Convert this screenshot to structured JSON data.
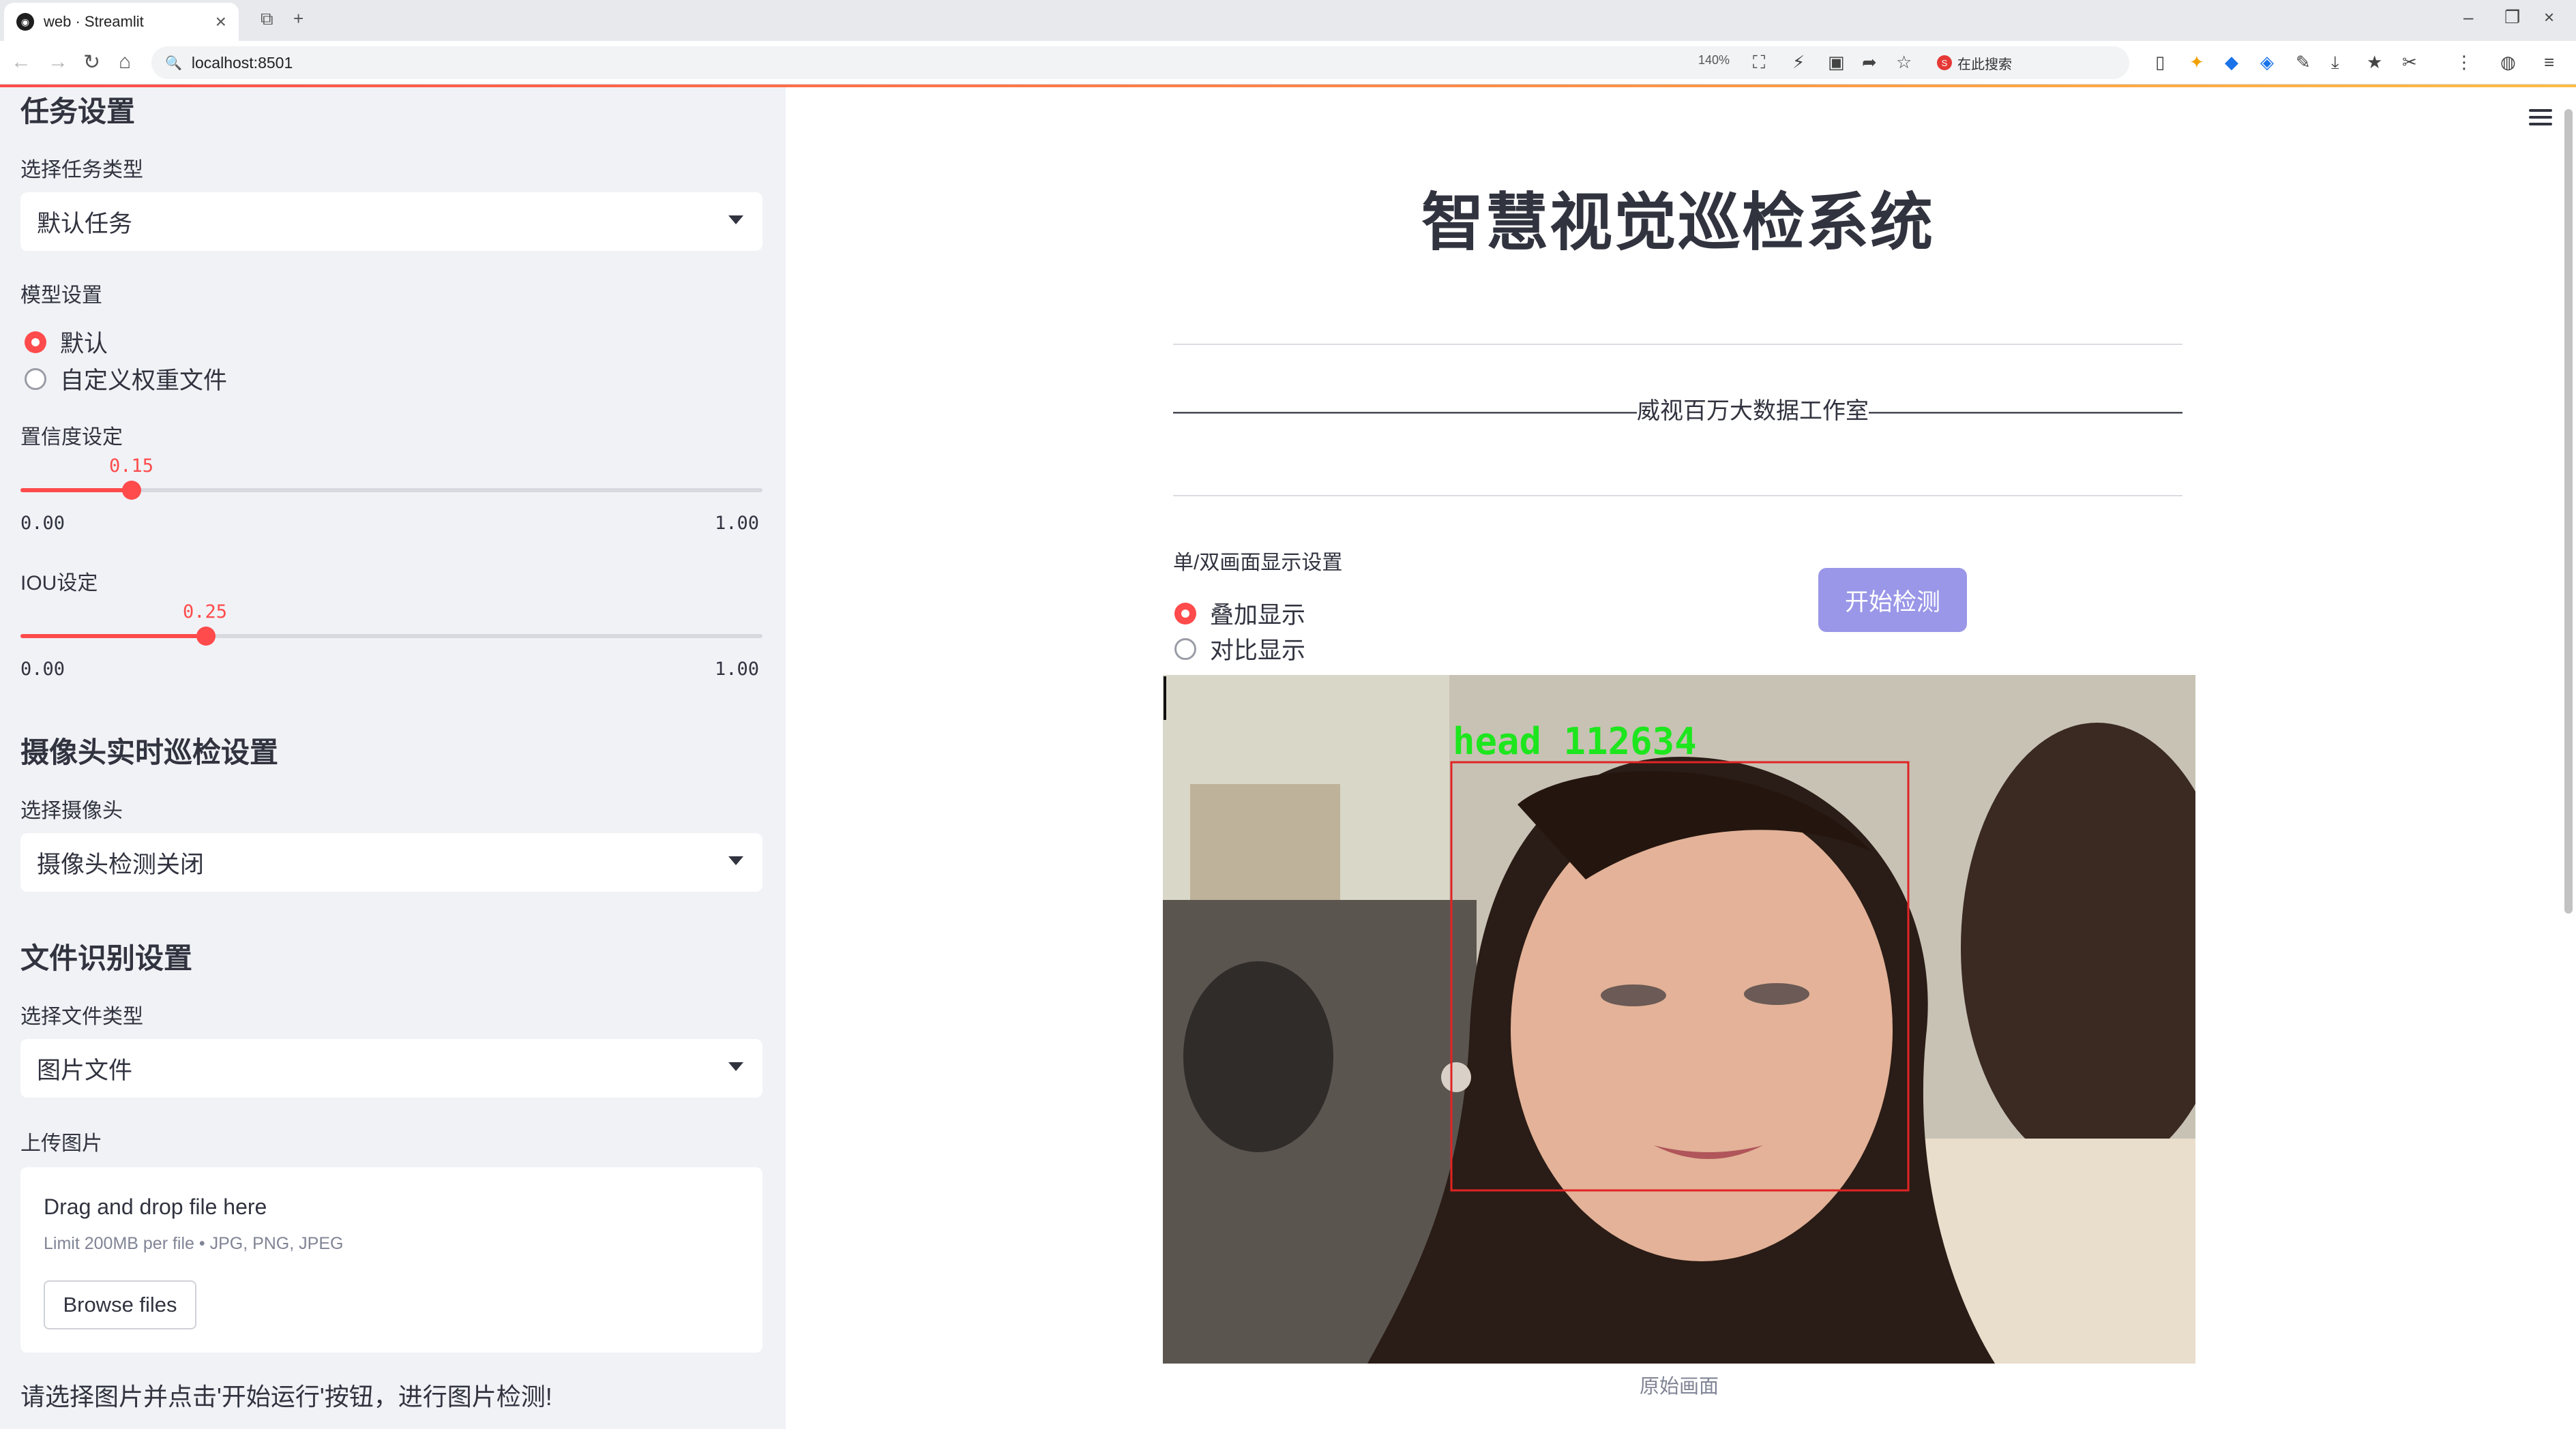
{
  "browser": {
    "tab_title": "web · Streamlit",
    "url": "localhost:8501",
    "zoom": "140%",
    "search_placeholder": "在此搜索"
  },
  "sidebar": {
    "task_section_title": "任务设置",
    "task_type_label": "选择任务类型",
    "task_type_value": "默认任务",
    "model_label": "模型设置",
    "model_options": [
      "默认",
      "自定义权重文件"
    ],
    "model_selected": 0,
    "confidence_label": "置信度设定",
    "confidence_value": "0.15",
    "confidence_min": "0.00",
    "confidence_max": "1.00",
    "confidence_fraction": 0.15,
    "iou_label": "IOU设定",
    "iou_value": "0.25",
    "iou_min": "0.00",
    "iou_max": "1.00",
    "iou_fraction": 0.25,
    "camera_section_title": "摄像头实时巡检设置",
    "camera_label": "选择摄像头",
    "camera_value": "摄像头检测关闭",
    "file_section_title": "文件识别设置",
    "file_type_label": "选择文件类型",
    "file_type_value": "图片文件",
    "upload_label": "上传图片",
    "upload_drop_text": "Drag and drop file here",
    "upload_limit_text": "Limit 200MB per file • JPG, PNG, JPEG",
    "browse_button": "Browse files",
    "hint": "请选择图片并点击'开始运行'按钮，进行图片检测!"
  },
  "main": {
    "title": "智慧视觉巡检系统",
    "subline": "————————————————————威视百万大数据工作室—————————————————————",
    "display_label": "单/双画面显示设置",
    "display_options": [
      "叠加显示",
      "对比显示"
    ],
    "display_selected": 0,
    "start_button": "开始检测",
    "detection_label": "head 112634",
    "box_color": "#e02424",
    "label_color": "#1ee61e",
    "image_caption": "原始画面"
  },
  "colors": {
    "accent": "#ff4b4b",
    "button_bg": "#9a97e8",
    "sidebar_bg": "#f0f2f6"
  }
}
